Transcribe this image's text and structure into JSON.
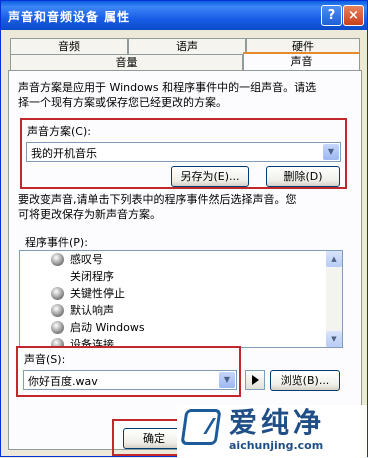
{
  "window": {
    "title": "声音和音频设备 属性",
    "help_button": "?",
    "close_button": "×"
  },
  "tabs_back": [
    "音频",
    "语声",
    "硬件"
  ],
  "tabs_front": [
    "音量",
    "声音"
  ],
  "description": [
    "声音方案是应用于 Windows 和程序事件中的一组声音。请选",
    "择一个现有方案或保存您已经更改的方案。"
  ],
  "scheme": {
    "label": "声音方案(C):",
    "value": "我的开机音乐"
  },
  "buttons": {
    "save_as": "另存为(E)...",
    "delete": "删除(D)",
    "browse": "浏览(B)...",
    "ok": "确定"
  },
  "instructions": [
    "要改变声音,请单击下列表中的程序事件然后选择声音。您",
    "可将更改保存为新声音方案。"
  ],
  "events": {
    "label": "程序事件(P):",
    "items": [
      {
        "name": "感叹号",
        "has_sound": true
      },
      {
        "name": "关闭程序",
        "has_sound": false
      },
      {
        "name": "关键性停止",
        "has_sound": true
      },
      {
        "name": "默认响声",
        "has_sound": true
      },
      {
        "name": "启动 Windows",
        "has_sound": true
      },
      {
        "name": "设备连接",
        "has_sound": true
      }
    ]
  },
  "sound": {
    "label": "声音(S):",
    "value": "你好百度.wav"
  },
  "watermark": {
    "cn": "爱纯净",
    "en": "aichunjing.com"
  },
  "colors": {
    "highlight_box": "#c0282c",
    "titlebar": "#0a5fe0"
  }
}
